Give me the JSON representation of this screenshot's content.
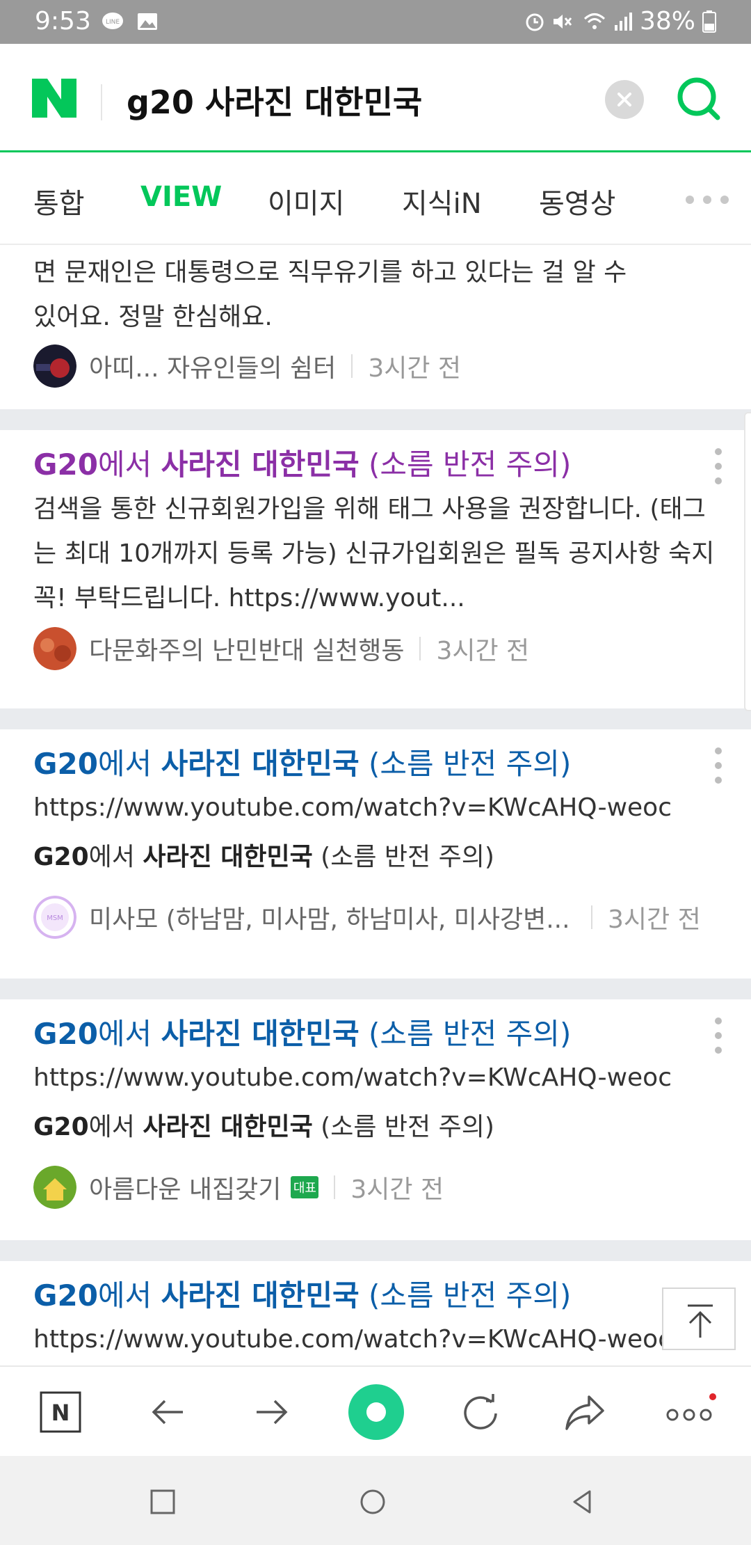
{
  "status_bar": {
    "time": "9:53",
    "battery": "38%",
    "icons": [
      "line-notification-icon",
      "gallery-notification-icon",
      "alarm-icon",
      "mute-icon",
      "wifi-icon",
      "signal-icon",
      "battery-icon"
    ]
  },
  "search": {
    "query": "g20 사라진 대한민국",
    "logo_letter": "N",
    "brand_color": "#03c75a"
  },
  "tabs": [
    {
      "label": "통합",
      "active": false
    },
    {
      "label": "VIEW",
      "active": true
    },
    {
      "label": "이미지",
      "active": false
    },
    {
      "label": "지식iN",
      "active": false
    },
    {
      "label": "동영상",
      "active": false
    }
  ],
  "results": [
    {
      "text_line1": "면 문재인은 대통령으로 직무유기를 하고 있다는 걸 알 수",
      "text_line2": "있어요. 정말 한심해요.",
      "author": "아띠... 자유인들의 쉼터",
      "time": "3시간 전"
    },
    {
      "title_prefix": "G20",
      "title_mid1": "에서 ",
      "title_kw1": "사라진 대한민국",
      "title_suffix": " (소름 반전 주의)",
      "title_color": "#8b2fa6",
      "text": "검색을 통한 신규회원가입을 위해 태그 사용을 권장합니다. (태그는 최대 10개까지 등록 가능) 신규가입회원은 필독 공지사항 숙지 꼭! 부탁드립니다. https://www.yout...",
      "author": "다문화주의 난민반대 실천행동",
      "time": "3시간 전"
    },
    {
      "title_prefix": "G20",
      "title_mid1": "에서 ",
      "title_kw1": "사라진 대한민국",
      "title_suffix": " (소름 반전 주의)",
      "title_color": "#0b5ea8",
      "url": "https://www.youtube.com/watch?v=KWcAHQ-weoc",
      "sub_bold1": "G20",
      "sub_mid": "에서 ",
      "sub_bold2": "사라진 대한민국",
      "sub_suffix": " (소름 반전 주의)",
      "author": "미사모 (하남맘, 미사맘, 하남미사, 미사강변...",
      "time": "3시간 전"
    },
    {
      "title_prefix": "G20",
      "title_mid1": "에서 ",
      "title_kw1": "사라진 대한민국",
      "title_suffix": " (소름 반전 주의)",
      "title_color": "#0b5ea8",
      "url": "https://www.youtube.com/watch?v=KWcAHQ-weoc",
      "sub_bold1": "G20",
      "sub_mid": "에서 ",
      "sub_bold2": "사라진 대한민국",
      "sub_suffix": " (소름 반전 주의)",
      "author": "아름다운 내집갖기",
      "badge": "대표",
      "time": "3시간 전"
    },
    {
      "title_prefix": "G20",
      "title_mid1": "에서 ",
      "title_kw1": "사라진 대한민국",
      "title_suffix": " (소름 반전 주의)",
      "title_color": "#0b5ea8",
      "url": "https://www.youtube.com/watch?v=KWcAHQ-weoc"
    }
  ],
  "toolbar": {
    "home_letter": "N",
    "icons": [
      "naver-home-icon",
      "back-arrow-icon",
      "forward-arrow-icon",
      "green-dot-icon",
      "reload-icon",
      "share-icon",
      "more-icon"
    ]
  },
  "navbar": {
    "icons": [
      "recent-apps-icon",
      "home-icon",
      "back-icon"
    ]
  }
}
